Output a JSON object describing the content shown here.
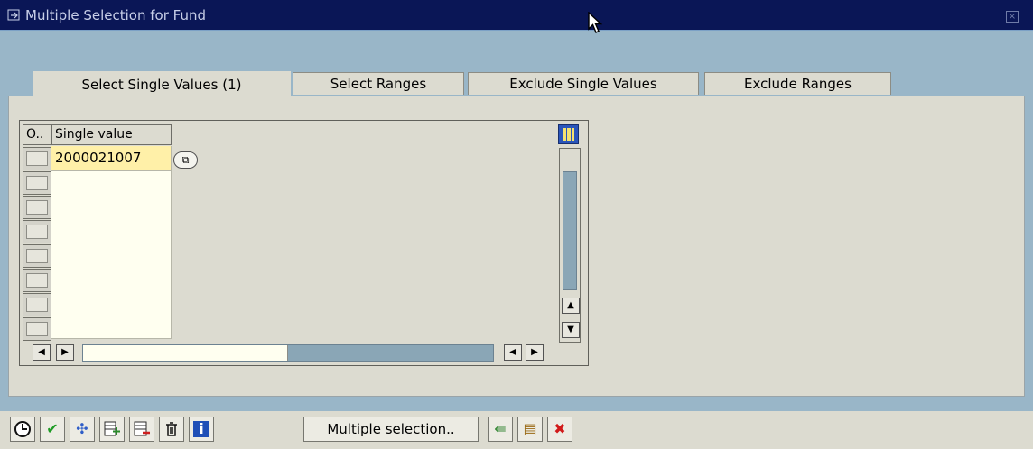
{
  "window": {
    "title": "Multiple Selection for Fund",
    "title_icon": "window-icon",
    "close_icon": "close-icon"
  },
  "tabs": [
    {
      "label": "Select Single Values (1)",
      "active": true
    },
    {
      "label": "Select Ranges",
      "active": false
    },
    {
      "label": "Exclude Single Values",
      "active": false
    },
    {
      "label": "Exclude Ranges",
      "active": false
    }
  ],
  "grid": {
    "columns": [
      "O..",
      "Single value"
    ],
    "rows": [
      {
        "value": "2000021007"
      },
      {
        "value": ""
      },
      {
        "value": ""
      },
      {
        "value": ""
      },
      {
        "value": ""
      },
      {
        "value": ""
      },
      {
        "value": ""
      },
      {
        "value": ""
      }
    ],
    "value_help_icon": "value-help-icon",
    "layout_icon": "column-layout-icon"
  },
  "toolbar": {
    "buttons": [
      {
        "icon": "execute-icon",
        "color": "#000000"
      },
      {
        "icon": "checkmark-icon",
        "color": "#1f9b25"
      },
      {
        "icon": "settings-icon",
        "color": "#2f5ec8"
      },
      {
        "icon": "insert-row-icon",
        "color": "#2a8a2a"
      },
      {
        "icon": "delete-row-icon",
        "color": "#ce2020"
      },
      {
        "icon": "trash-icon",
        "color": "#000000"
      },
      {
        "icon": "info-icon",
        "color": "#1f4fb7"
      }
    ],
    "multiple_selection_label": "Multiple selection..",
    "after_buttons": [
      {
        "icon": "import-icon",
        "color": "#3a8a3a"
      },
      {
        "icon": "clipboard-icon",
        "color": "#9a6a15"
      },
      {
        "icon": "cancel-icon",
        "color": "#d11a1a"
      }
    ]
  }
}
